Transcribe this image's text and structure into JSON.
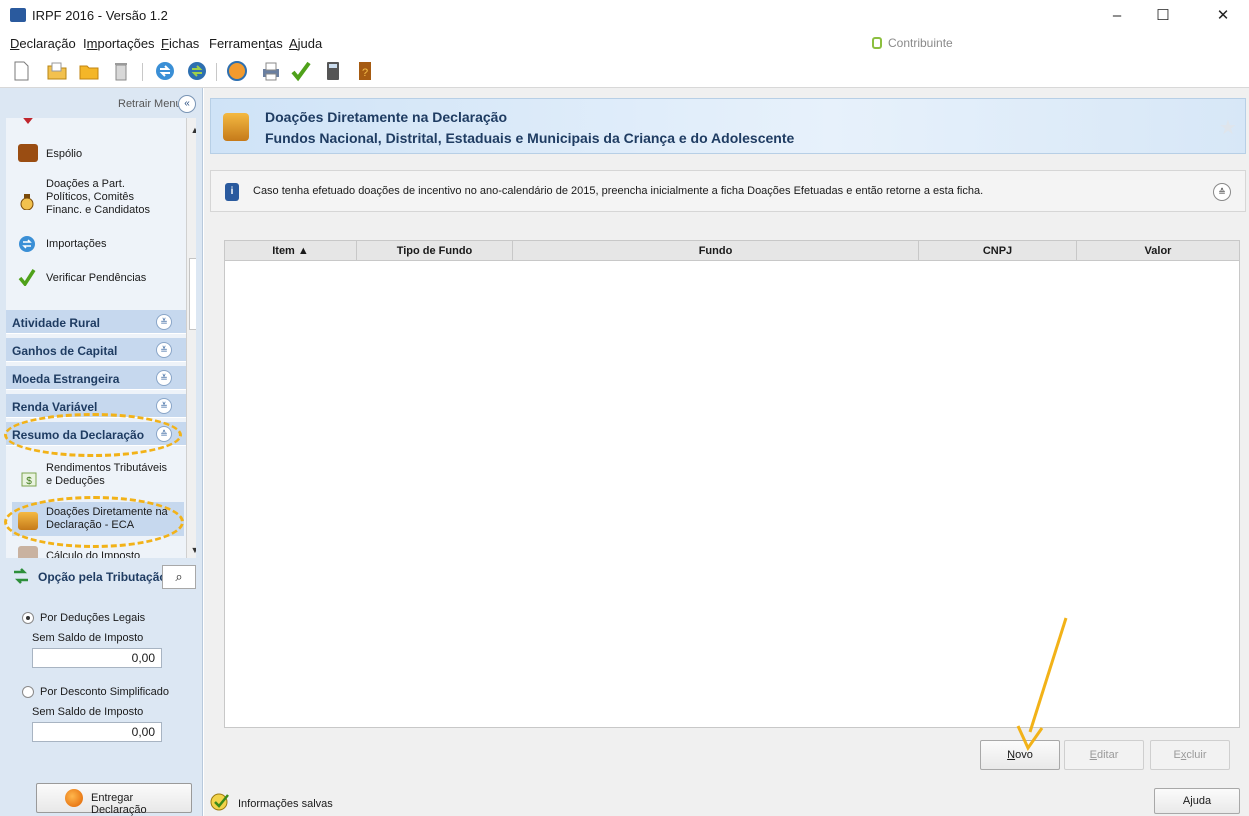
{
  "window": {
    "title": "IRPF 2016 - Versão 1.2",
    "controls": [
      "–",
      "☐",
      "✕"
    ]
  },
  "menubar": {
    "items": [
      {
        "pre": "",
        "ul": "D",
        "post": "eclaração"
      },
      {
        "pre": "I",
        "ul": "m",
        "post": "portações"
      },
      {
        "pre": "",
        "ul": "F",
        "post": "ichas"
      },
      {
        "pre": "Ferramen",
        "ul": "t",
        "post": "as"
      },
      {
        "pre": "",
        "ul": "A",
        "post": "juda"
      }
    ],
    "contribuinte": "Contribuinte"
  },
  "sidebar": {
    "retrair_label": "Retrair Menu",
    "items": {
      "espolio": "Espólio",
      "doacoes_part_1": "Doações a Part.",
      "doacoes_part_2": "Políticos, Comitês",
      "doacoes_part_3": "Financ. e Candidatos",
      "importacoes": "Importações",
      "verificar": "Verificar Pendências"
    },
    "sections": [
      {
        "label": "Atividade Rural",
        "chev": "≚"
      },
      {
        "label": "Ganhos de Capital",
        "chev": "≚"
      },
      {
        "label": "Moeda Estrangeira",
        "chev": "≚"
      },
      {
        "label": "Renda Variável",
        "chev": "≚"
      },
      {
        "label": "Resumo da Declaração",
        "chev": "≙"
      }
    ],
    "resumo_items": {
      "rendimentos_1": "Rendimentos Tributáveis",
      "rendimentos_2": "e Deduções",
      "doacoes_eca_1": "Doações Diretamente na",
      "doacoes_eca_2": "Declaração - ECA",
      "calculo": "Cálculo do Imposto"
    },
    "opcao_label": "Opção pela Tributação:",
    "tributacao": {
      "option1": "Por Deduções Legais",
      "saldo1_label": "Sem Saldo de Imposto",
      "saldo1_value": "0,00",
      "option2": "Por Desconto Simplificado",
      "saldo2_label": "Sem Saldo de Imposto",
      "saldo2_value": "0,00",
      "selected": "Por Deduções Legais"
    },
    "entregar_label": "Entregar Declaração"
  },
  "main": {
    "title": "Doações Diretamente na Declaração",
    "subtitle": "Fundos Nacional, Distrital, Estaduais e Municipais da Criança e do Adolescente",
    "info_text": "Caso tenha efetuado doações de incentivo no ano-calendário de 2015, preencha inicialmente a ficha Doações Efetuadas e então retorne a esta ficha.",
    "table": {
      "columns": [
        "Item ▲",
        "Tipo de Fundo",
        "Fundo",
        "CNPJ",
        "Valor"
      ],
      "rows": []
    },
    "buttons": {
      "novo": {
        "ul": "N",
        "post": "ovo"
      },
      "editar": {
        "ul": "E",
        "post": "ditar"
      },
      "excluir": {
        "pre": "E",
        "ul": "x",
        "post": "cluir"
      }
    },
    "status": "Informações salvas",
    "ajuda": {
      "ul": "A",
      "post": "juda"
    }
  },
  "colors": {
    "accent": "#1f3c62",
    "annotation": "#f2b218",
    "sidebar_bg": "#dce7f3"
  }
}
